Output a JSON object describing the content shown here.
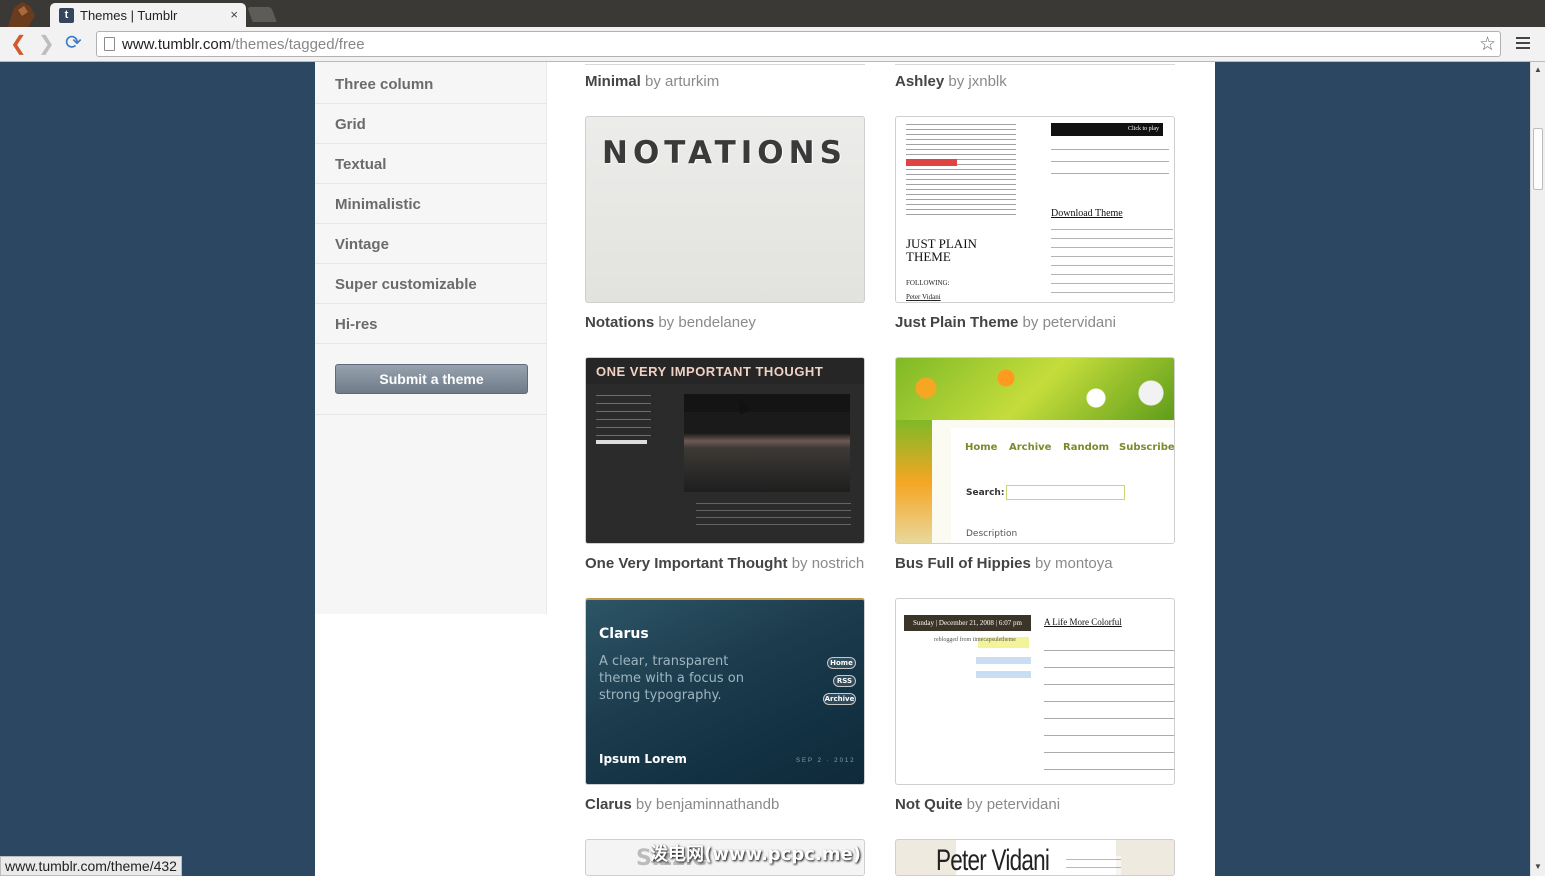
{
  "browser": {
    "tab_title": "Themes | Tumblr",
    "tab_close": "×",
    "favicon_letter": "t",
    "url_host": "www.tumblr.com",
    "url_path": "/themes/tagged/free",
    "status_url": "www.tumblr.com/theme/432",
    "watermark": "泼电网(www.pcpc.me)",
    "icons": {
      "back": "back-arrow-icon",
      "forward": "forward-arrow-icon",
      "reload": "reload-icon",
      "bookmark": "star-icon",
      "menu": "hamburger-menu-icon"
    }
  },
  "sidebar": {
    "items": [
      {
        "label": "Three column"
      },
      {
        "label": "Grid"
      },
      {
        "label": "Textual"
      },
      {
        "label": "Minimalistic"
      },
      {
        "label": "Vintage"
      },
      {
        "label": "Super customizable"
      },
      {
        "label": "Hi-res"
      }
    ],
    "submit_label": "Submit a theme"
  },
  "themes": [
    {
      "name": "Minimal",
      "by": "by",
      "author": "arturkim"
    },
    {
      "name": "Ashley",
      "by": "by",
      "author": "jxnblk"
    },
    {
      "name": "Notations",
      "by": "by",
      "author": "bendelaney",
      "thumb_title": "NOTATIONS"
    },
    {
      "name": "Just Plain Theme",
      "by": "by",
      "author": "petervidani",
      "thumb": {
        "title_line1": "JUST PLAIN",
        "title_line2": "THEME",
        "player": "Click to play",
        "download": "Download Theme",
        "following": "FOLLOWING:",
        "following_name": "Peter Vidani"
      }
    },
    {
      "name": "One Very Important Thought",
      "by": "by",
      "author": "nostrich",
      "thumb_title": "ONE VERY IMPORTANT THOUGHT"
    },
    {
      "name": "Bus Full of Hippies",
      "by": "by",
      "author": "montoya",
      "thumb": {
        "nav": [
          "Home",
          "Archive",
          "Random",
          "Subscribe"
        ],
        "search": "Search:",
        "description": "Description"
      }
    },
    {
      "name": "Clarus",
      "by": "by",
      "author": "benjaminnathandb",
      "thumb": {
        "title": "Clarus",
        "tagline": "A clear, transparent theme with a focus on strong typography.",
        "pills": [
          "Home",
          "RSS",
          "Archive"
        ],
        "post": "Ipsum Lorem",
        "date": "SEP 2 · 2012"
      }
    },
    {
      "name": "Not Quite",
      "by": "by",
      "author": "petervidani",
      "thumb": {
        "date": "Sunday | December 21, 2008 | 6:07 pm",
        "reblogged": "reblogged from",
        "reblog_source": "timecapsuletheme",
        "post_title": "A Life More Colorful"
      }
    },
    {
      "name": "",
      "by": "",
      "author": "",
      "thumb_title": "Sizzle"
    },
    {
      "name": "",
      "by": "",
      "author": "",
      "thumb_title": "Peter Vidani"
    }
  ]
}
